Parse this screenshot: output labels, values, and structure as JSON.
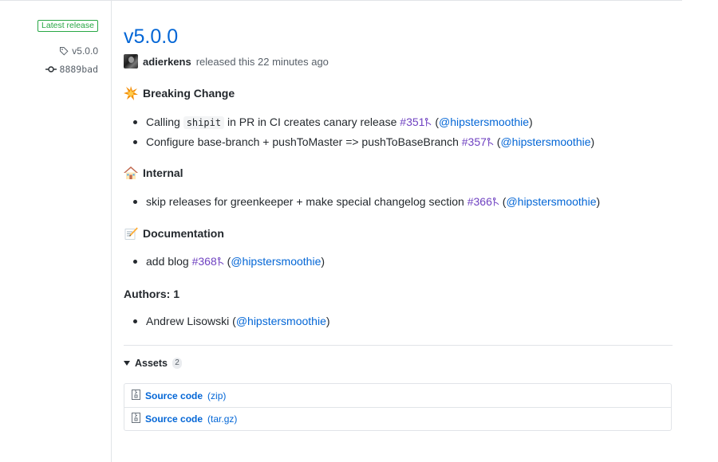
{
  "meta": {
    "latest_badge": "Latest release",
    "tag": "v5.0.0",
    "commit": "8889bad"
  },
  "release": {
    "title": "v5.0.0",
    "author": "adierkens",
    "released_text": "released this 22 minutes ago"
  },
  "sections": {
    "breaking": {
      "title": "Breaking Change",
      "items": [
        {
          "pre": "Calling ",
          "code": "shipit",
          "text": " in PR in CI creates canary release ",
          "pr": "#351",
          "open": " (",
          "user": "@hipstersmoothie",
          "close": ")"
        },
        {
          "text": "Configure base-branch + pushToMaster => pushToBaseBranch ",
          "pr": "#357",
          "open": " (",
          "user": "@hipstersmoothie",
          "close": ")"
        }
      ]
    },
    "internal": {
      "title": "Internal",
      "items": [
        {
          "text": "skip releases for greenkeeper + make special changelog section ",
          "pr": "#366",
          "open": " (",
          "user": "@hipstersmoothie",
          "close": ")"
        }
      ]
    },
    "documentation": {
      "title": "Documentation",
      "items": [
        {
          "text": "add blog ",
          "pr": "#368",
          "open": " (",
          "user": "@hipstersmoothie",
          "close": ")"
        }
      ]
    }
  },
  "authors": {
    "heading": "Authors: 1",
    "items": [
      {
        "name": "Andrew Lisowski ",
        "open": "(",
        "user": "@hipstersmoothie",
        "close": ")"
      }
    ]
  },
  "assets": {
    "label": "Assets",
    "count": "2",
    "items": [
      {
        "name": "Source code",
        "ext": "(zip)"
      },
      {
        "name": "Source code",
        "ext": "(tar.gz)"
      }
    ]
  },
  "colors": {
    "link": "#0366d6",
    "pr": "#6f42c1",
    "latest_badge": "#28a745",
    "muted": "#586069",
    "border": "#e1e4e8"
  },
  "icons": {
    "tag": "tag-icon",
    "commit": "commit-icon",
    "breaking": "collision-emoji-icon",
    "internal": "house-emoji-icon",
    "documentation": "memo-emoji-icon",
    "pr": "pull-request-icon",
    "assets_toggle": "triangle-down-icon",
    "archive": "file-zip-icon"
  }
}
